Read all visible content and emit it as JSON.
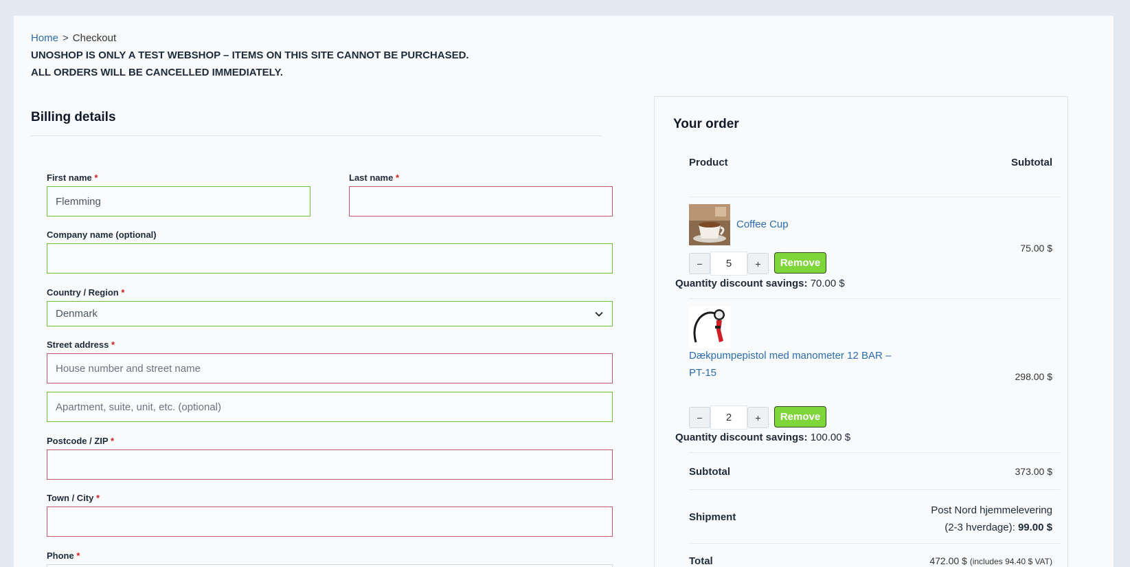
{
  "breadcrumb": {
    "home": "Home",
    "separator": ">",
    "current": "Checkout"
  },
  "notice": {
    "line1": "UNOSHOP IS ONLY A TEST WEBSHOP – ITEMS ON THIS SITE CANNOT BE PURCHASED.",
    "line2": "ALL ORDERS WILL BE CANCELLED IMMEDIATELY."
  },
  "billing": {
    "title": "Billing details",
    "required_mark": "*",
    "first_name": {
      "label": "First name",
      "value": "Flemming"
    },
    "last_name": {
      "label": "Last name",
      "value": ""
    },
    "company": {
      "label": "Company name (optional)",
      "value": ""
    },
    "country": {
      "label": "Country / Region",
      "value": "Denmark"
    },
    "street": {
      "label": "Street address",
      "placeholder1": "House number and street name",
      "placeholder2": "Apartment, suite, unit, etc. (optional)"
    },
    "postcode": {
      "label": "Postcode / ZIP",
      "value": ""
    },
    "city": {
      "label": "Town / City",
      "value": ""
    },
    "phone": {
      "label": "Phone",
      "value": ""
    }
  },
  "order": {
    "title": "Your order",
    "col_product": "Product",
    "col_subtotal": "Subtotal",
    "items": [
      {
        "name": "Coffee Cup",
        "qty": "5",
        "minus": "−",
        "plus": "+",
        "remove": "Remove",
        "savings_label": "Quantity discount savings:",
        "savings_value": "70.00 $",
        "price": "75.00 $"
      },
      {
        "name_line1": "Dækpumpepistol med manometer 12 BAR –",
        "name_line2": "PT-15",
        "qty": "2",
        "minus": "−",
        "plus": "+",
        "remove": "Remove",
        "savings_label": "Quantity discount savings:",
        "savings_value": "100.00 $",
        "price": "298.00 $"
      }
    ],
    "subtotal_label": "Subtotal",
    "subtotal_value": "373.00 $",
    "shipment_label": "Shipment",
    "shipment_line1": "Post Nord hjemmelevering",
    "shipment_line2": "(2-3 hverdage):",
    "shipment_price": "99.00 $",
    "total_label": "Total",
    "total_value": "472.00 $",
    "total_vat": "(includes 94.40 $ VAT)"
  },
  "colors": {
    "valid_border": "#6cbf3f",
    "invalid_border": "#c05a64",
    "link": "#2b6cb0",
    "remove_button": "#7ed63a",
    "required": "#d11d1d"
  }
}
